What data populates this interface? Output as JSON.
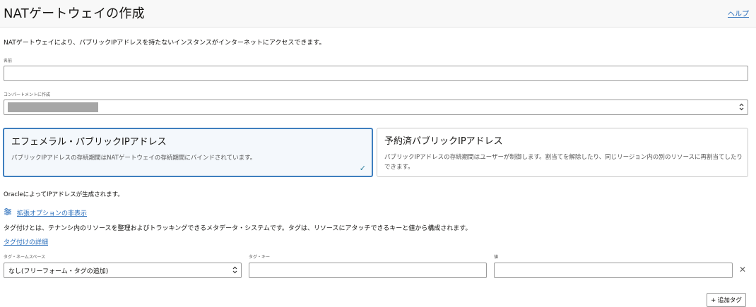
{
  "header": {
    "title": "NATゲートウェイの作成",
    "help_label": "ヘルプ"
  },
  "description": "NATゲートウェイにより、パブリックIPアドレスを持たないインスタンスがインターネットにアクセスできます。",
  "name_field": {
    "label": "名前",
    "value": ""
  },
  "compartment_field": {
    "label": "コンパートメントに作成",
    "value": ""
  },
  "ip_options": [
    {
      "title": "エフェメラル・パブリックIPアドレス",
      "description": "パブリックIPアドレスの存続期間はNATゲートウェイの存続期間にバインドされています。",
      "selected": true
    },
    {
      "title": "予約済パブリックIPアドレス",
      "description": "パブリックIPアドレスの存続期間はユーザーが制御します。割当てを解除したり、同じリージョン内の別のリソースに再割当てしたりできます。",
      "selected": false
    }
  ],
  "ip_note": "OracleによってIPアドレスが生成されます。",
  "advanced": {
    "toggle_label": "拡張オプションの非表示",
    "tag_description": "タグ付けとは、テナンシ内のリソースを整理およびトラッキングできるメタデータ・システムです。タグは、リソースにアタッチできるキーと値から構成されます。",
    "tag_details_link": "タグ付けの詳細"
  },
  "tags": {
    "namespace_label": "タグ・ネームスペース",
    "namespace_value": "なし(フリーフォーム・タグの追加)",
    "key_label": "タグ・キー",
    "key_value": "",
    "value_label": "値",
    "value_value": "",
    "add_tag_label": "+ 追加タグ"
  }
}
